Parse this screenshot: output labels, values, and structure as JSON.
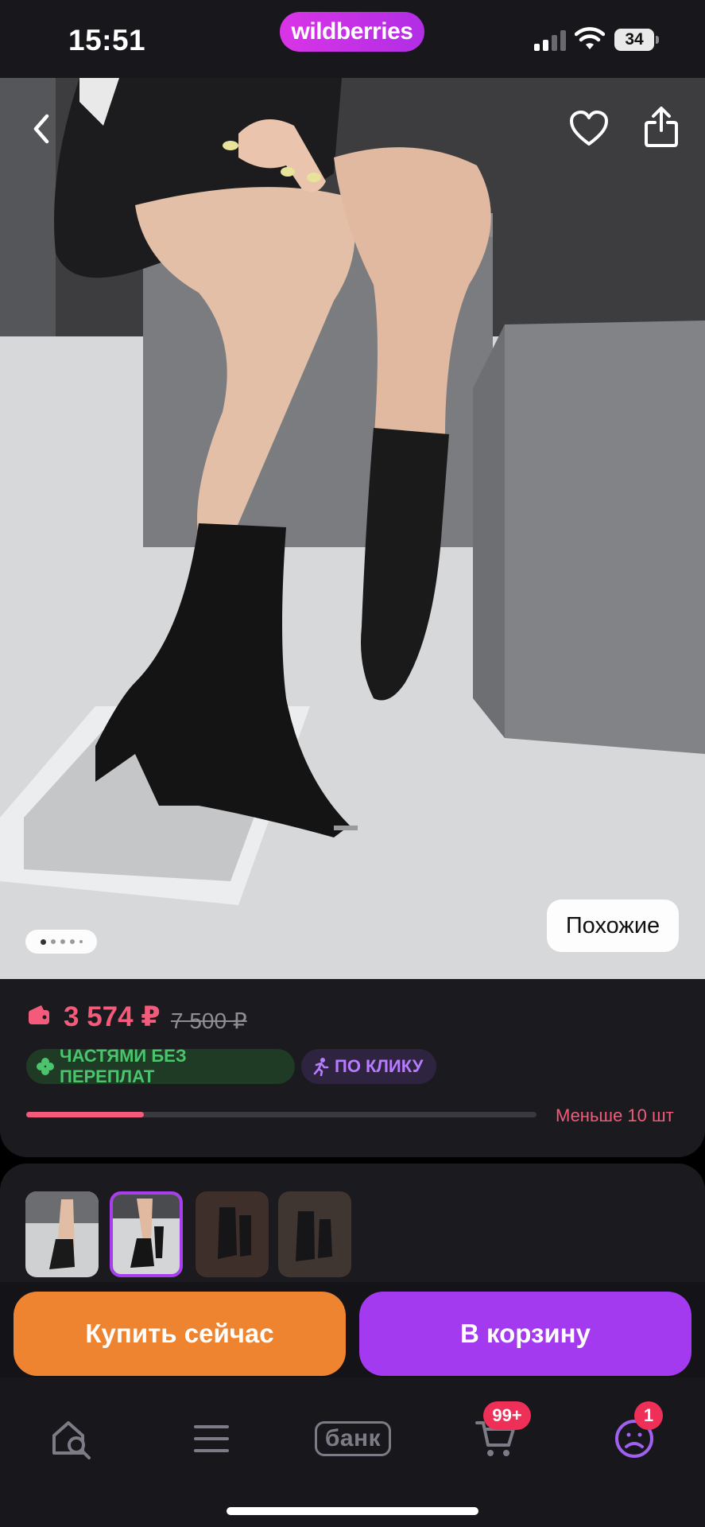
{
  "status_bar": {
    "time": "15:51",
    "brand": "wildberries",
    "battery": "34"
  },
  "photo": {
    "similar_label": "Похожие",
    "gallery_dots": 5,
    "active_dot": 1
  },
  "price": {
    "current": "3 574 ₽",
    "old": "7 500 ₽",
    "badge_installments": "ЧАСТЯМИ БЕЗ ПЕРЕПЛАТ",
    "badge_one_click": "ПО КЛИКУ",
    "stock_text": "Меньше 10 шт",
    "stock_fraction": 0.23
  },
  "thumbnails": {
    "count": 4,
    "selected_index": 1
  },
  "actions": {
    "buy_now": "Купить сейчас",
    "add_to_cart": "В корзину"
  },
  "tabbar": {
    "bank_label": "банк",
    "cart_badge": "99+",
    "profile_badge": "1"
  },
  "colors": {
    "accent_pink": "#f45b7a",
    "buy_orange": "#ef8430",
    "cart_purple": "#a43af0",
    "brand_magenta": "#d934e6",
    "badge_red": "#ee2f57"
  }
}
